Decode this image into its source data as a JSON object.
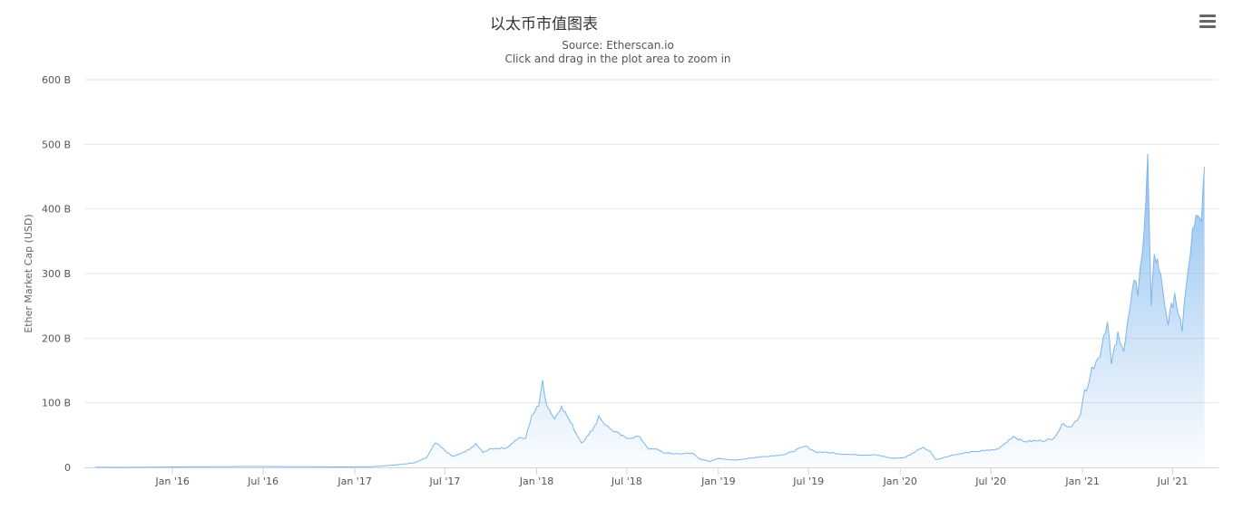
{
  "title": "以太币市值图表",
  "subtitle_source": "Source: Etherscan.io",
  "subtitle_hint": "Click and drag in the plot area to zoom in",
  "menu_icon": "hamburger-menu-icon",
  "colors": {
    "line": "#7cb5ec",
    "fill_top": "#90c0ee",
    "grid": "#e6e6e6",
    "axis": "#ccd6eb"
  },
  "chart_data": {
    "type": "area",
    "title": "以太币市值图表",
    "subtitle": "Source: Etherscan.io",
    "xlabel": "",
    "ylabel": "Ether Market Cap (USD)",
    "xlim": [
      "2015-07-08",
      "2021-10-01"
    ],
    "ylim": [
      0,
      600
    ],
    "y_ticks": [
      {
        "v": 0,
        "label": "0"
      },
      {
        "v": 100,
        "label": "100 B"
      },
      {
        "v": 200,
        "label": "200 B"
      },
      {
        "v": 300,
        "label": "300 B"
      },
      {
        "v": 400,
        "label": "400 B"
      },
      {
        "v": 500,
        "label": "500 B"
      },
      {
        "v": 600,
        "label": "600 B"
      }
    ],
    "x_ticks": [
      {
        "date": "2016-01-01",
        "label": "Jan '16"
      },
      {
        "date": "2016-07-01",
        "label": "Jul '16"
      },
      {
        "date": "2017-01-01",
        "label": "Jan '17"
      },
      {
        "date": "2017-07-01",
        "label": "Jul '17"
      },
      {
        "date": "2018-01-01",
        "label": "Jan '18"
      },
      {
        "date": "2018-07-01",
        "label": "Jul '18"
      },
      {
        "date": "2019-01-01",
        "label": "Jan '19"
      },
      {
        "date": "2019-07-01",
        "label": "Jul '19"
      },
      {
        "date": "2020-01-01",
        "label": "Jan '20"
      },
      {
        "date": "2020-07-01",
        "label": "Jul '20"
      },
      {
        "date": "2021-01-01",
        "label": "Jan '21"
      },
      {
        "date": "2021-07-01",
        "label": "Jul '21"
      }
    ],
    "grid": true,
    "legend": "none",
    "unit": "billion USD",
    "series": [
      {
        "name": "Ether Market Cap",
        "points": [
          [
            "2015-07-30",
            0.1
          ],
          [
            "2015-10-01",
            0.05
          ],
          [
            "2016-01-01",
            0.7
          ],
          [
            "2016-03-01",
            0.9
          ],
          [
            "2016-06-15",
            1.5
          ],
          [
            "2016-09-01",
            1.1
          ],
          [
            "2016-12-01",
            0.7
          ],
          [
            "2017-02-01",
            0.9
          ],
          [
            "2017-03-20",
            3.5
          ],
          [
            "2017-05-01",
            7
          ],
          [
            "2017-05-25",
            15
          ],
          [
            "2017-06-12",
            38
          ],
          [
            "2017-06-25",
            30
          ],
          [
            "2017-07-16",
            17
          ],
          [
            "2017-08-01",
            21
          ],
          [
            "2017-08-20",
            28
          ],
          [
            "2017-09-01",
            37
          ],
          [
            "2017-09-15",
            23
          ],
          [
            "2017-10-01",
            29
          ],
          [
            "2017-11-01",
            30
          ],
          [
            "2017-11-25",
            45
          ],
          [
            "2017-12-10",
            45
          ],
          [
            "2017-12-22",
            80
          ],
          [
            "2018-01-05",
            95
          ],
          [
            "2018-01-13",
            135
          ],
          [
            "2018-01-20",
            100
          ],
          [
            "2018-02-06",
            75
          ],
          [
            "2018-02-20",
            95
          ],
          [
            "2018-03-10",
            70
          ],
          [
            "2018-04-01",
            38
          ],
          [
            "2018-04-15",
            50
          ],
          [
            "2018-05-01",
            68
          ],
          [
            "2018-05-06",
            80
          ],
          [
            "2018-05-20",
            65
          ],
          [
            "2018-06-01",
            58
          ],
          [
            "2018-06-30",
            45
          ],
          [
            "2018-07-25",
            48
          ],
          [
            "2018-08-15",
            28
          ],
          [
            "2018-09-01",
            28
          ],
          [
            "2018-09-15",
            22
          ],
          [
            "2018-10-15",
            21
          ],
          [
            "2018-11-10",
            22
          ],
          [
            "2018-11-25",
            13
          ],
          [
            "2018-12-15",
            9
          ],
          [
            "2019-01-01",
            14
          ],
          [
            "2019-02-05",
            11
          ],
          [
            "2019-03-01",
            14
          ],
          [
            "2019-04-05",
            17
          ],
          [
            "2019-05-15",
            20
          ],
          [
            "2019-06-25",
            33
          ],
          [
            "2019-07-15",
            24
          ],
          [
            "2019-08-10",
            23
          ],
          [
            "2019-09-20",
            20
          ],
          [
            "2019-10-20",
            19
          ],
          [
            "2019-11-10",
            20
          ],
          [
            "2019-12-15",
            14
          ],
          [
            "2020-01-10",
            15
          ],
          [
            "2020-02-15",
            31
          ],
          [
            "2020-03-01",
            25
          ],
          [
            "2020-03-13",
            12
          ],
          [
            "2020-04-15",
            19
          ],
          [
            "2020-05-15",
            23
          ],
          [
            "2020-06-20",
            26
          ],
          [
            "2020-07-15",
            28
          ],
          [
            "2020-08-15",
            48
          ],
          [
            "2020-09-05",
            40
          ],
          [
            "2020-10-01",
            41
          ],
          [
            "2020-11-01",
            43
          ],
          [
            "2020-11-24",
            68
          ],
          [
            "2020-12-10",
            63
          ],
          [
            "2020-12-28",
            82
          ],
          [
            "2021-01-05",
            120
          ],
          [
            "2021-01-12",
            125
          ],
          [
            "2021-01-20",
            155
          ],
          [
            "2021-02-05",
            170
          ],
          [
            "2021-02-20",
            225
          ],
          [
            "2021-02-28",
            160
          ],
          [
            "2021-03-13",
            210
          ],
          [
            "2021-03-25",
            180
          ],
          [
            "2021-04-05",
            240
          ],
          [
            "2021-04-15",
            290
          ],
          [
            "2021-04-22",
            265
          ],
          [
            "2021-05-01",
            330
          ],
          [
            "2021-05-08",
            410
          ],
          [
            "2021-05-12",
            485
          ],
          [
            "2021-05-19",
            250
          ],
          [
            "2021-05-25",
            330
          ],
          [
            "2021-06-07",
            300
          ],
          [
            "2021-06-22",
            220
          ],
          [
            "2021-07-05",
            270
          ],
          [
            "2021-07-20",
            210
          ],
          [
            "2021-08-01",
            305
          ],
          [
            "2021-08-10",
            370
          ],
          [
            "2021-08-20",
            390
          ],
          [
            "2021-08-28",
            380
          ],
          [
            "2021-09-03",
            465
          ]
        ]
      }
    ]
  }
}
